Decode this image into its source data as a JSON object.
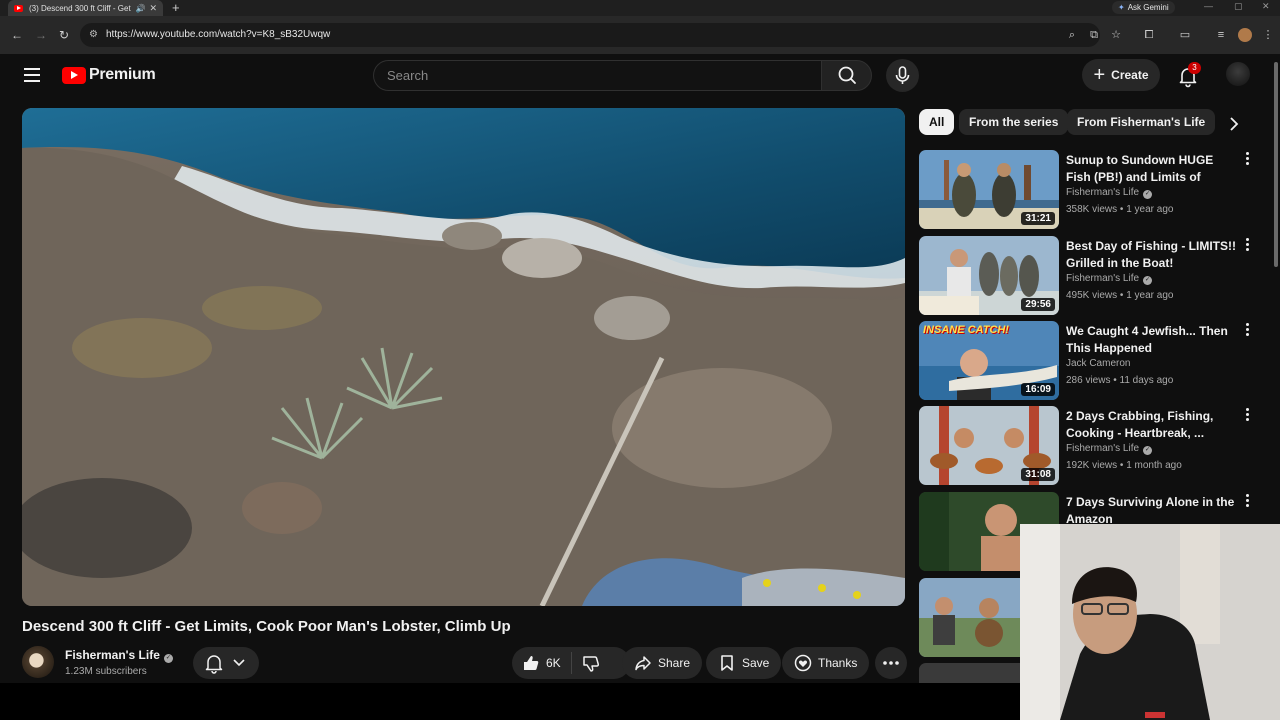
{
  "browser": {
    "tab_title": "(3) Descend 300 ft Cliff - Get Limits",
    "url": "https://www.youtube.com/watch?v=K8_sB32Uwqw",
    "gemini_label": "Ask Gemini"
  },
  "header": {
    "logo_text": "Premium",
    "search_placeholder": "Search",
    "create_label": "Create",
    "notification_count": "3"
  },
  "video": {
    "title": "Descend 300 ft Cliff - Get Limits, Cook Poor Man's Lobster, Climb Up",
    "channel": "Fisherman's Life",
    "subscribers": "1.23M subscribers",
    "likes": "6K",
    "share_label": "Share",
    "save_label": "Save",
    "thanks_label": "Thanks"
  },
  "chips": [
    {
      "label": "All",
      "active": true
    },
    {
      "label": "From the series",
      "active": false
    },
    {
      "label": "From Fisherman's Life",
      "active": false
    }
  ],
  "recommendations": [
    {
      "title": "Sunup to Sundown HUGE Fish (PB!) and Limits of Dungeness...",
      "channel": "Fisherman's Life",
      "verified": true,
      "meta": "358K views • 1 year ago",
      "duration": "31:21"
    },
    {
      "title": "Best Day of Fishing - LIMITS!! Grilled in the Boat!",
      "channel": "Fisherman's Life",
      "verified": true,
      "meta": "495K views • 1 year ago",
      "duration": "29:56"
    },
    {
      "title": "We Caught 4 Jewfish... Then This Happened",
      "channel": "Jack Cameron",
      "verified": false,
      "meta": "286 views • 11 days ago",
      "duration": "16:09",
      "thumb_text": "INSANE CATCH!"
    },
    {
      "title": "2 Days Crabbing, Fishing, Cooking - Heartbreak, ...",
      "channel": "Fisherman's Life",
      "verified": true,
      "meta": "192K views • 1 month ago",
      "duration": "31:08"
    },
    {
      "title": "7 Days Surviving Alone in the Amazon",
      "channel": "",
      "verified": false,
      "meta": "",
      "duration": ""
    }
  ],
  "colors": {
    "background": "#0f0f0f",
    "surface": "#272727",
    "accent": "#ff0000",
    "text_secondary": "#aaaaaa"
  }
}
